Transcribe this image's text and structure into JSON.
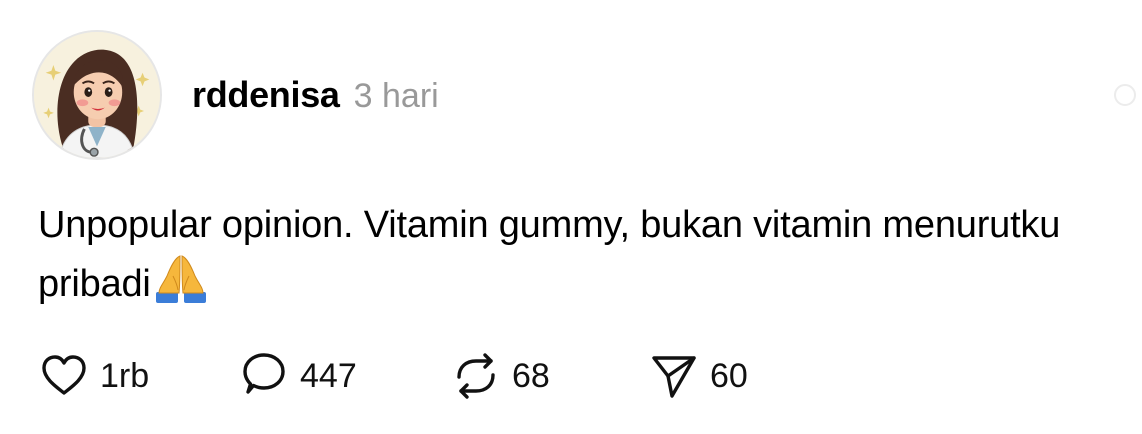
{
  "post": {
    "username": "rddenisa",
    "timestamp": "3 hari",
    "text": "Unpopular opinion. Vitamin gummy, bukan vitamin menurutku pribadi",
    "emoji": "folded-hands-emoji",
    "avatar_icon": "cartoon-doctor-avatar",
    "watermark_icon": "threads-logo-icon"
  },
  "actions": {
    "likes": {
      "icon": "heart-icon",
      "count": "1rb"
    },
    "replies": {
      "icon": "comment-icon",
      "count": "447"
    },
    "reposts": {
      "icon": "repost-icon",
      "count": "68"
    },
    "shares": {
      "icon": "send-icon",
      "count": "60"
    }
  },
  "colors": {
    "text": "#000000",
    "muted": "#999999",
    "icon": "#111111",
    "background": "#ffffff"
  }
}
